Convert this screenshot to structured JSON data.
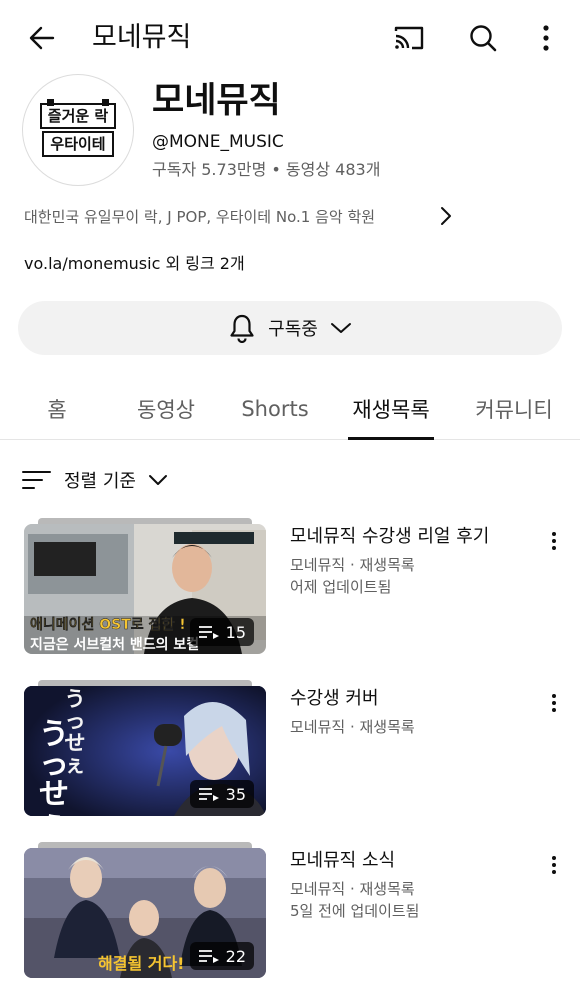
{
  "top_bar": {
    "title": "모네뮤직",
    "back_icon": "arrow-left-icon",
    "cast_icon": "cast-icon",
    "search_icon": "search-icon",
    "more_icon": "more-vert-icon"
  },
  "channel": {
    "avatar": {
      "line1": "즐거운 락",
      "line2": "우타이테"
    },
    "name": "모네뮤직",
    "handle": "@MONE_MUSIC",
    "stats": "구독자 5.73만명 • 동영상 483개",
    "description": "대한민국 유일무이 락, J POP, 우타이테 No.1 음악 학원",
    "links": "vo.la/monemusic 외 링크 2개",
    "subscribe_label": "구독중"
  },
  "tabs": [
    {
      "label": "홈",
      "active": false
    },
    {
      "label": "동영상",
      "active": false
    },
    {
      "label": "Shorts",
      "active": false
    },
    {
      "label": "재생목록",
      "active": true
    },
    {
      "label": "커뮤니티",
      "active": false
    }
  ],
  "sort": {
    "label": "정렬 기준"
  },
  "playlists": [
    {
      "title": "모네뮤직 수강생 리얼 후기",
      "meta1": "모네뮤직 · 재생목록",
      "meta2": "어제 업데이트됨",
      "count": "15",
      "caption1": "애니메이션 OST로 접한 !",
      "caption2": "지금은 서브컬처 밴드의 보컬"
    },
    {
      "title": "수강생 커버",
      "meta1": "모네뮤직 · 재생목록",
      "meta2": "",
      "count": "35",
      "caption1": "うっせぇ",
      "caption2": "うっせぇ"
    },
    {
      "title": "모네뮤직 소식",
      "meta1": "모네뮤직 · 재생목록",
      "meta2": "5일 전에 업데이트됨",
      "count": "22",
      "caption1": "해결될 거다!",
      "caption2": ""
    }
  ],
  "colors": {
    "text_primary": "#0f0f0f",
    "text_secondary": "#606060",
    "pill_bg": "#f2f2f2",
    "caption_yellow": "#f6c531"
  }
}
